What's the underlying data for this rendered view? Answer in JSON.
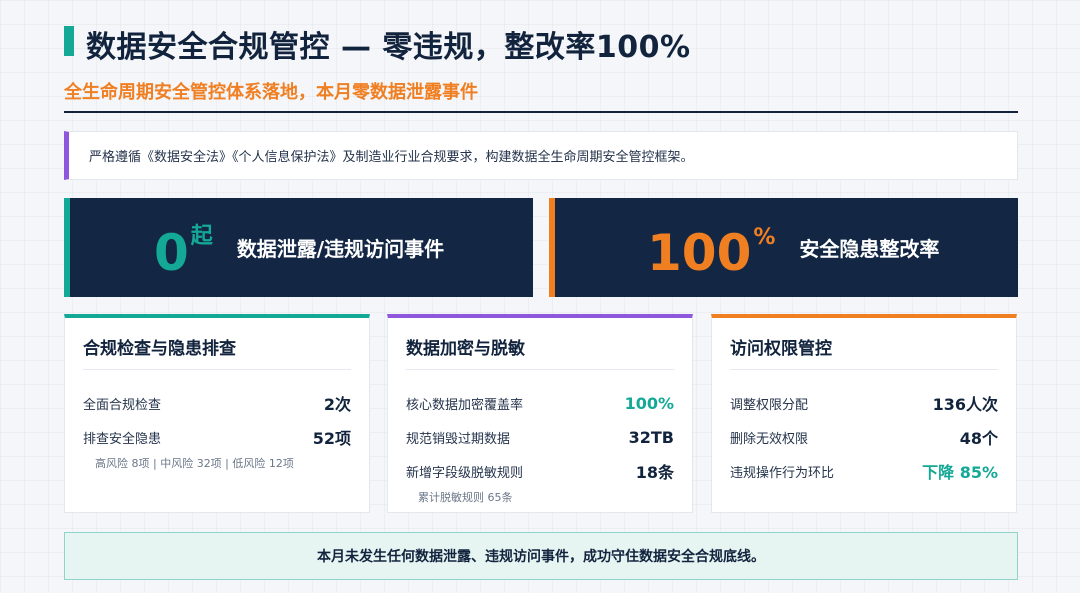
{
  "header": {
    "title": "数据安全合规管控 — 零违规，整改率100%",
    "subtitle": "全生命周期安全管控体系落地，本月零数据泄露事件"
  },
  "intro": "严格遵循《数据安全法》《个人信息保护法》及制造业行业合规要求，构建数据全生命周期安全管控框架。",
  "kpis": [
    {
      "value": "0",
      "unit": "起",
      "label": "数据泄露/违规访问事件",
      "accent": "#14a896"
    },
    {
      "value": "100",
      "unit": "%",
      "label": "安全隐患整改率",
      "accent": "#f07f22"
    }
  ],
  "cards": [
    {
      "title": "合规检查与隐患排查",
      "accent": "#14a896",
      "rows": [
        {
          "label": "全面合规检查",
          "value": "2次"
        },
        {
          "label": "排查安全隐患",
          "value": "52项"
        }
      ],
      "note": "高风险 8项 | 中风险 32项 | 低风险 12项"
    },
    {
      "title": "数据加密与脱敏",
      "accent": "#8e57de",
      "rows": [
        {
          "label": "核心数据加密覆盖率",
          "value": "100%"
        },
        {
          "label": "规范销毁过期数据",
          "value": "32TB"
        },
        {
          "label": "新增字段级脱敏规则",
          "value": "18条"
        }
      ],
      "note": "累计脱敏规则 65条"
    },
    {
      "title": "访问权限管控",
      "accent": "#f07f22",
      "rows": [
        {
          "label": "调整权限分配",
          "value": "136人次"
        },
        {
          "label": "删除无效权限",
          "value": "48个"
        },
        {
          "label": "违规操作行为环比",
          "value": "下降 85%"
        }
      ]
    }
  ],
  "banner": "本月未发生任何数据泄露、违规访问事件，成功守住数据安全合规底线。",
  "colors": {
    "navy": "#132745",
    "teal": "#14a896",
    "orange": "#f07f22",
    "purple": "#8e57de"
  }
}
